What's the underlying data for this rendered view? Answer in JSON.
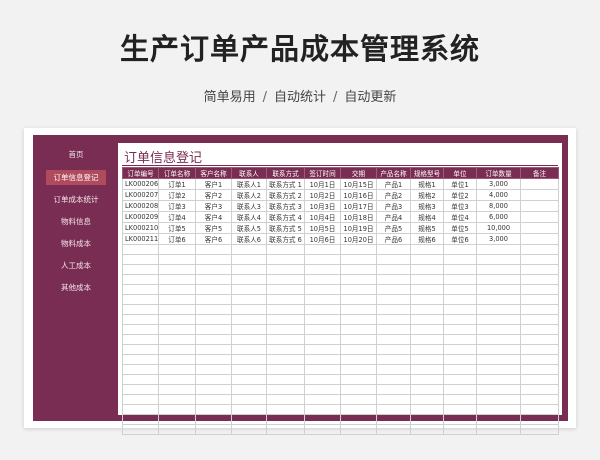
{
  "header": {
    "title": "生产订单产品成本管理系统",
    "subtitle": [
      "简单易用",
      "自动统计",
      "自动更新"
    ],
    "separator": "/"
  },
  "sidebar": {
    "items": [
      {
        "label": "首页"
      },
      {
        "label": "订单信息登记",
        "active": true
      },
      {
        "label": "订单成本统计"
      },
      {
        "label": "物料信息"
      },
      {
        "label": "物料成本"
      },
      {
        "label": "人工成本"
      },
      {
        "label": "其他成本"
      }
    ]
  },
  "panel": {
    "title": "订单信息登记",
    "columns": [
      "订单编号",
      "订单名称",
      "客户名称",
      "联系人",
      "联系方式",
      "签订时间",
      "交期",
      "产品名称",
      "规格型号",
      "单位",
      "订单数量",
      "备注"
    ],
    "rows": [
      [
        "LK000206",
        "订单1",
        "客户1",
        "联系人1",
        "联系方式 1",
        "10月1日",
        "10月15日",
        "产品1",
        "规格1",
        "单位1",
        "3,000",
        ""
      ],
      [
        "LK000207",
        "订单2",
        "客户2",
        "联系人2",
        "联系方式 2",
        "10月2日",
        "10月16日",
        "产品2",
        "规格2",
        "单位2",
        "4,000",
        ""
      ],
      [
        "LK000208",
        "订单3",
        "客户3",
        "联系人3",
        "联系方式 3",
        "10月3日",
        "10月17日",
        "产品3",
        "规格3",
        "单位3",
        "8,000",
        ""
      ],
      [
        "LK000209",
        "订单4",
        "客户4",
        "联系人4",
        "联系方式 4",
        "10月4日",
        "10月18日",
        "产品4",
        "规格4",
        "单位4",
        "6,000",
        ""
      ],
      [
        "LK000210",
        "订单5",
        "客户5",
        "联系人5",
        "联系方式 5",
        "10月5日",
        "10月19日",
        "产品5",
        "规格5",
        "单位5",
        "10,000",
        ""
      ],
      [
        "LK000211",
        "订单6",
        "客户6",
        "联系人6",
        "联系方式 6",
        "10月6日",
        "10月20日",
        "产品6",
        "规格6",
        "单位6",
        "3,000",
        ""
      ]
    ],
    "blank_rows": 19
  },
  "colors": {
    "brand": "#7a2d52",
    "active_nav": "#b04b5d"
  }
}
